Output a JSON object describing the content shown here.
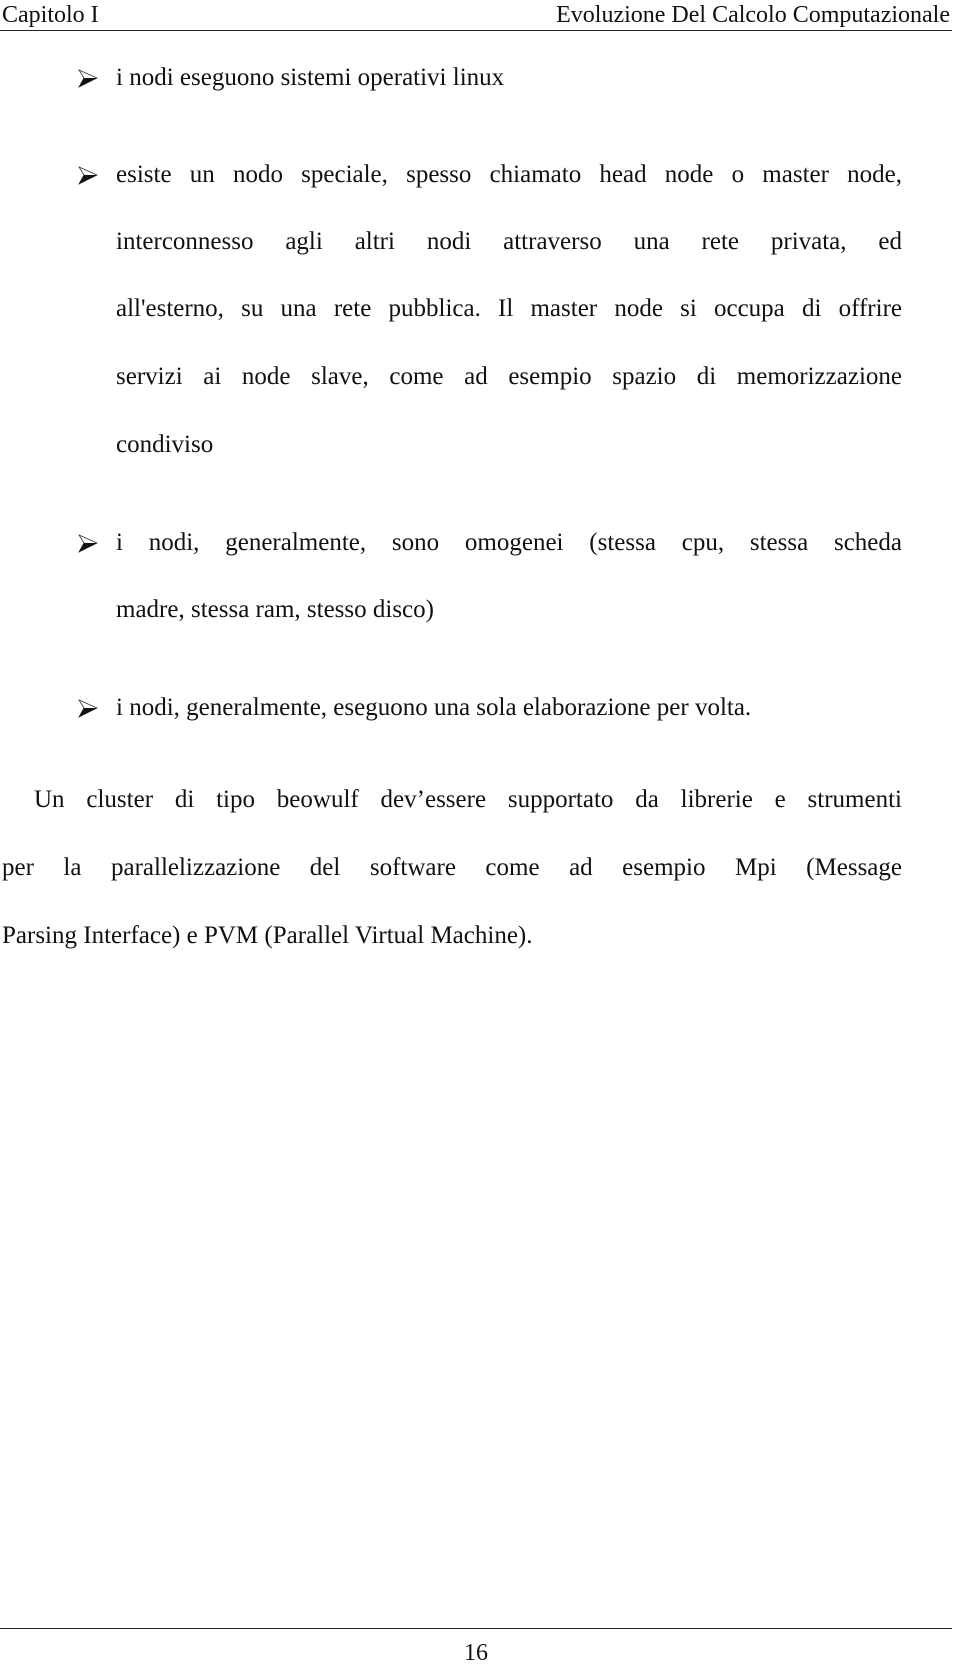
{
  "header": {
    "chapter": "Capitolo I",
    "section_title": "Evoluzione Del Calcolo Computazionale"
  },
  "bullets": [
    {
      "icon": "arrowhead-bullet-icon",
      "lines": [
        "i nodi eseguono sistemi operativi linux"
      ]
    },
    {
      "icon": "arrowhead-bullet-icon",
      "lines": [
        "esiste un nodo speciale, spesso chiamato head node o master node,",
        "interconnesso agli altri nodi attraverso una rete privata, ed",
        "all'esterno, su una rete pubblica. Il master node si occupa di offrire",
        "servizi ai node slave, come ad esempio spazio di memorizzazione",
        "condiviso"
      ]
    },
    {
      "icon": "arrowhead-bullet-icon",
      "lines": [
        "i nodi, generalmente, sono omogenei (stessa cpu, stessa scheda",
        "madre, stessa ram, stesso disco)"
      ]
    },
    {
      "icon": "arrowhead-bullet-icon",
      "lines": [
        "i nodi, generalmente, eseguono una sola elaborazione per volta."
      ]
    }
  ],
  "paragraph": {
    "lines": [
      "Un cluster di tipo beowulf  dev’essere supportato da librerie e strumenti",
      "per la parallelizzazione del software come ad esempio Mpi (Message",
      "Parsing Interface) e PVM (Parallel Virtual Machine)."
    ]
  },
  "footer": {
    "page_number": "16"
  }
}
